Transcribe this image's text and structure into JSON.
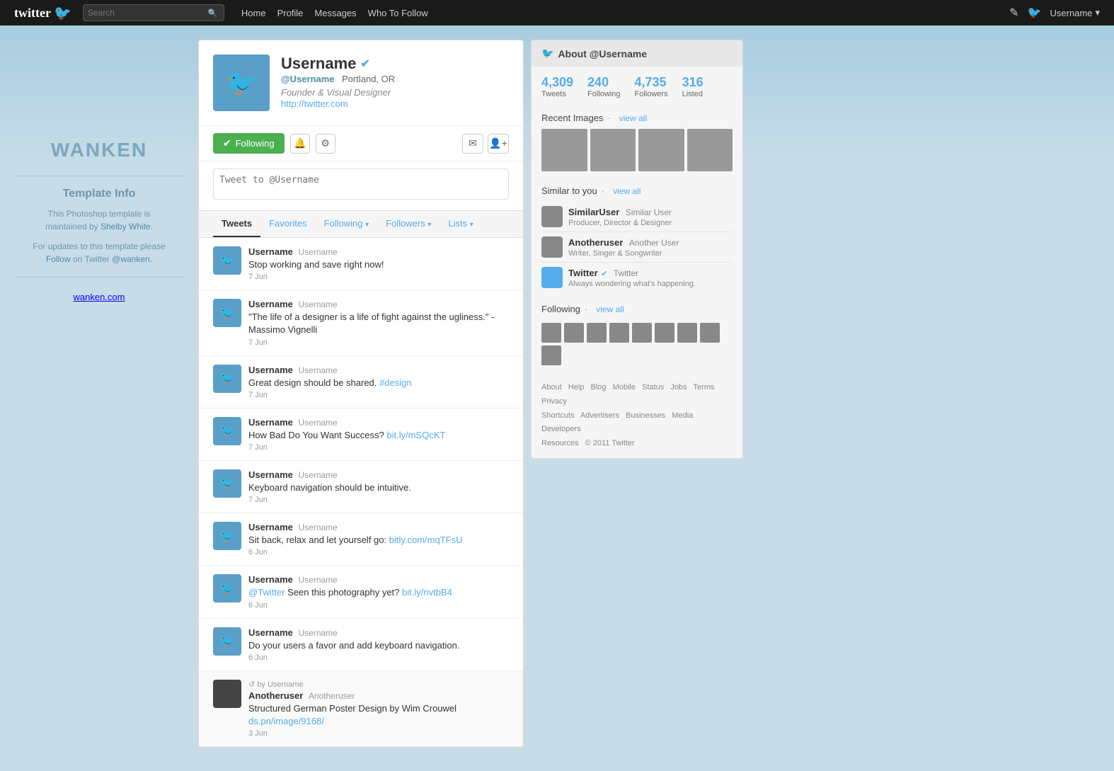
{
  "nav": {
    "logo": "twitter",
    "bird": "🐦",
    "search_placeholder": "Search",
    "links": [
      "Home",
      "Profile",
      "Messages",
      "Who To Follow"
    ],
    "username": "Username",
    "compose_icon": "✎",
    "twitter_icon": "🐦"
  },
  "sidebar_left": {
    "brand": "WANKEN",
    "template_info_title": "Template Info",
    "template_desc_1": "This Photoshop template is",
    "template_desc_2": "maintained by",
    "shelby_name": "Shelby White",
    "template_desc_3": ".",
    "template_update_1": "For updates to this template please",
    "follow_label": "Follow",
    "twitter_label": "on Twitter",
    "handle": "@wanken",
    "url": "wanken.com"
  },
  "profile": {
    "username": "Username",
    "verified": "✔",
    "handle": "@Username",
    "location": "Portland, OR",
    "bio": "Founder & Visual Designer",
    "website": "http://twitter.com",
    "following_label": "Following",
    "tweet_placeholder": "Tweet to @Username"
  },
  "tabs": {
    "tweets": "Tweets",
    "favorites": "Favorites",
    "following": "Following",
    "followers": "Followers",
    "lists": "Lists"
  },
  "tweets": [
    {
      "author": "Username",
      "handle": "Username",
      "text": "Stop working and save right now!",
      "time": "7 Jun",
      "type": "normal"
    },
    {
      "author": "Username",
      "handle": "Username",
      "text": "\"The life of a designer is a life of fight against the ugliness.\" - Massimo Vignelli",
      "time": "7 Jun",
      "type": "normal"
    },
    {
      "author": "Username",
      "handle": "Username",
      "text": "Great design should be shared.",
      "link": "#design",
      "time": "7 Jun",
      "type": "link"
    },
    {
      "author": "Username",
      "handle": "Username",
      "text": "How Bad Do You Want Success?",
      "link": "bit.ly/mSQcKT",
      "time": "7 Jun",
      "type": "link"
    },
    {
      "author": "Username",
      "handle": "Username",
      "text": "Keyboard navigation should be intuitive.",
      "time": "7 Jun",
      "type": "normal"
    },
    {
      "author": "Username",
      "handle": "Username",
      "text": "Sit back, relax and let yourself go:",
      "link": "bitly.com/mqTFsU",
      "time": "6 Jun",
      "type": "link"
    },
    {
      "author": "Username",
      "handle": "Username",
      "text_before": "",
      "mention": "@Twitter",
      "text": "Seen this photography yet?",
      "link": "bit.ly/nvtbB4",
      "time": "6 Jun",
      "type": "mention"
    },
    {
      "author": "Username",
      "handle": "Username",
      "text": "Do your users a favor and add keyboard navigation.",
      "time": "6 Jun",
      "type": "normal"
    },
    {
      "author": "Anotheruser",
      "handle": "Anotheruser",
      "rt_by": "by Username",
      "text": "Structured German Poster Design by Wim Crouwel",
      "link": "ds.pn/image/9168/",
      "time": "3 Jun",
      "type": "retweet"
    }
  ],
  "about": {
    "title": "About @Username",
    "stats": {
      "tweets": "4,309",
      "tweets_label": "Tweets",
      "following": "240",
      "following_label": "Following",
      "followers": "4,735",
      "followers_label": "Followers",
      "listed": "316",
      "listed_label": "Listed"
    },
    "recent_images_label": "Recent Images",
    "view_all": "view all",
    "similar_label": "Similar to you",
    "following_label": "Following",
    "similar_users": [
      {
        "name": "SimilarUser",
        "handle": "Similar User",
        "bio": "Producer, Director & Designer"
      },
      {
        "name": "Anotheruser",
        "handle": "Another User",
        "bio": "Writer, Singer & Songwriter"
      },
      {
        "name": "Twitter",
        "handle": "Twitter",
        "bio": "Always wondering what's happening.",
        "verified": true
      }
    ]
  },
  "footer": {
    "links": [
      "About",
      "Help",
      "Blog",
      "Mobile",
      "Status",
      "Jobs",
      "Terms",
      "Privacy",
      "Shortcuts",
      "Advertisers",
      "Businesses",
      "Media",
      "Developers",
      "Resources"
    ],
    "copyright": "© 2011 Twitter"
  }
}
